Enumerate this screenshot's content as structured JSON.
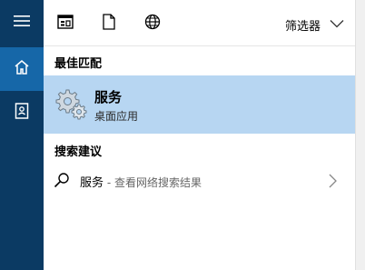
{
  "rail": {
    "items": [
      {
        "icon": "hamburger-menu-icon"
      },
      {
        "icon": "home-icon",
        "active": true
      },
      {
        "icon": "notebook-icon"
      }
    ]
  },
  "toolbar": {
    "icons": [
      "apps-icon",
      "document-icon",
      "globe-icon"
    ],
    "filter_label": "筛选器"
  },
  "sections": {
    "best_match": "最佳匹配",
    "search_suggestions": "搜索建议"
  },
  "best_match_item": {
    "title": "服务",
    "subtitle": "桌面应用",
    "icon": "services-gear-icon"
  },
  "web_suggestion": {
    "term": "服务",
    "separator": " - ",
    "description": "查看网络搜索结果"
  },
  "colors": {
    "rail": "#0b3a63",
    "rail_active": "#1667a8",
    "selected_bg": "#b7d6f2"
  }
}
